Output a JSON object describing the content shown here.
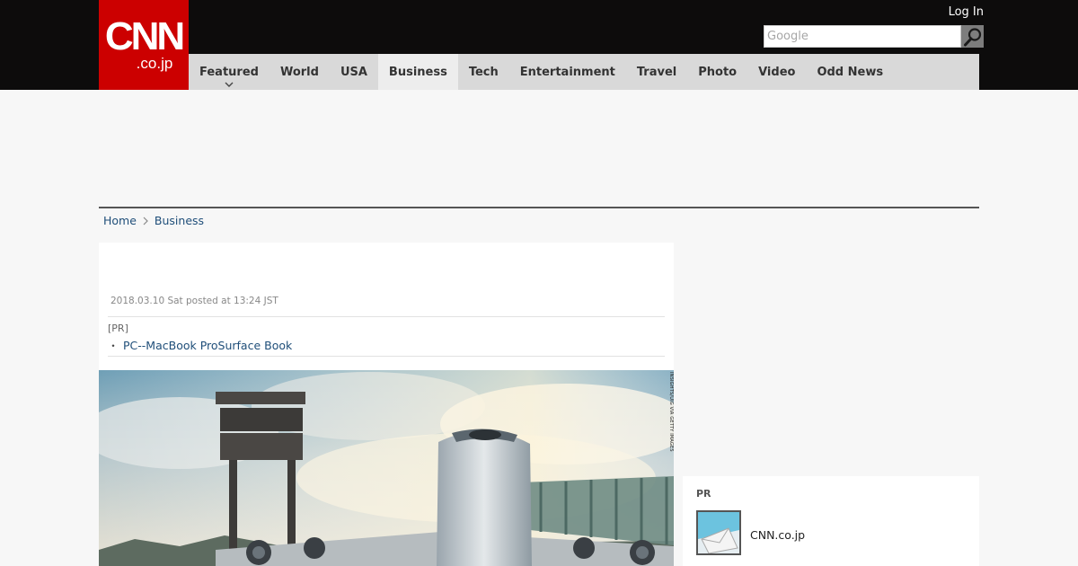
{
  "header": {
    "logo": {
      "main": "CNN",
      "sub": ".co.jp"
    },
    "login_label": "Log In",
    "search": {
      "placeholder": "Google"
    }
  },
  "nav": {
    "items": [
      {
        "label": "Featured"
      },
      {
        "label": "World"
      },
      {
        "label": "USA"
      },
      {
        "label": "Business"
      },
      {
        "label": "Tech"
      },
      {
        "label": "Entertainment"
      },
      {
        "label": "Travel"
      },
      {
        "label": "Photo"
      },
      {
        "label": "Video"
      },
      {
        "label": "Odd News"
      }
    ],
    "active_index": 3,
    "dropdown_index": 0
  },
  "breadcrumb": {
    "items": [
      "Home",
      "Business"
    ]
  },
  "article": {
    "posted": "2018.03.10 Sat posted at 13:24 JST",
    "pr": {
      "label": "[PR]",
      "link_bullet": "・",
      "link": "PC--MacBook ProSurface Book"
    },
    "image_credit": "INSIGHTS/UIG VIA GETTY IMAGES"
  },
  "sidebar": {
    "label": "PR",
    "items": [
      {
        "title": "CNN.co.jp"
      }
    ]
  },
  "colors": {
    "topbar": "#0d0c0c",
    "logo_red": "#cc0000",
    "nav_bg": "#d9d9d9",
    "nav_active": "#ededed",
    "link": "#1f4e79"
  },
  "icons": {
    "search": "magnifier-icon",
    "chevron": "chevron-down-icon",
    "breadcrumb_sep": "chevron-right-icon"
  }
}
